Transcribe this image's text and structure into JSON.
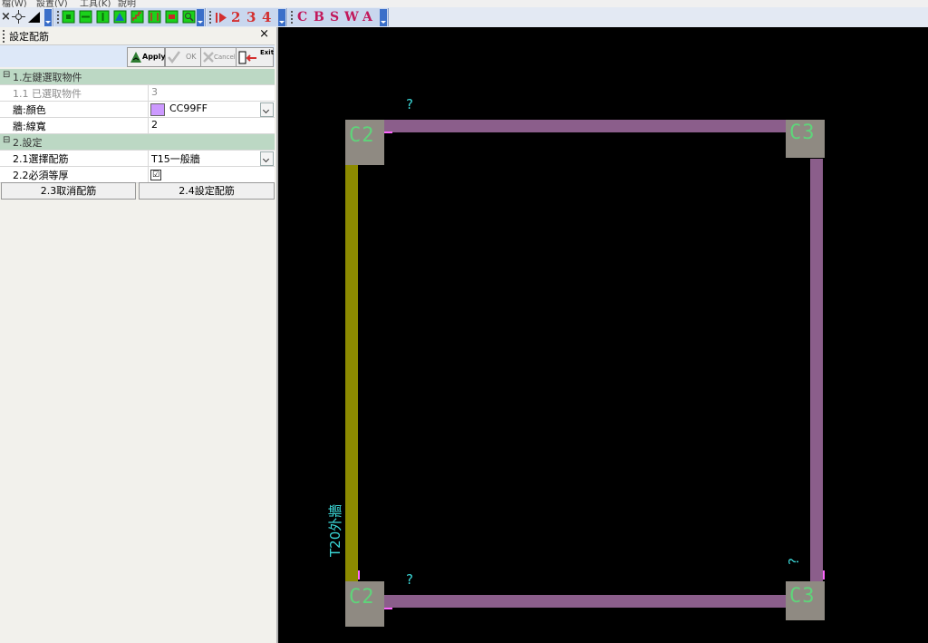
{
  "menu": [
    "檔(W)",
    "設置(V)",
    "工具(K)",
    "說明"
  ],
  "toolbar": {
    "numbers": [
      "2",
      "3",
      "4"
    ],
    "letters": [
      "C",
      "B",
      "S",
      "W",
      "A"
    ]
  },
  "panel": {
    "title": "設定配筋",
    "close_label": "×",
    "buttons": {
      "apply": "Apply",
      "ok": "OK",
      "cancel": "Cancel",
      "exit": "Exit"
    },
    "sections": [
      {
        "expander": "⊟",
        "label": "1.左鍵選取物件",
        "rows": [
          {
            "key": "1.1 已選取物件",
            "value": "3"
          },
          {
            "key": "牆:顏色",
            "value": "CC99FF",
            "swatch": "#CC99FF"
          },
          {
            "key": "牆:線寬",
            "value": "2"
          }
        ]
      },
      {
        "expander": "⊟",
        "label": "2.設定",
        "rows": [
          {
            "key": "2.1選擇配筋",
            "value": "T15一般牆"
          },
          {
            "key": "2.2必須等厚",
            "value": "☑"
          }
        ]
      }
    ],
    "actions": {
      "cancel_rebar": "2.3取消配筋",
      "set_rebar": "2.4設定配筋"
    }
  },
  "drawing": {
    "columns": {
      "tl": "C2",
      "tr": "C3",
      "bl": "C2",
      "br": "C3"
    },
    "question_mark": "?",
    "wall_label": "T20外牆",
    "colors": {
      "wall": "#8b5e8b",
      "selected_wall": "#8c8a00",
      "column": "#8f8a82",
      "column_text": "#5fd47a",
      "annotation": "#3ad5d5",
      "marker": "#ff66ff"
    }
  }
}
